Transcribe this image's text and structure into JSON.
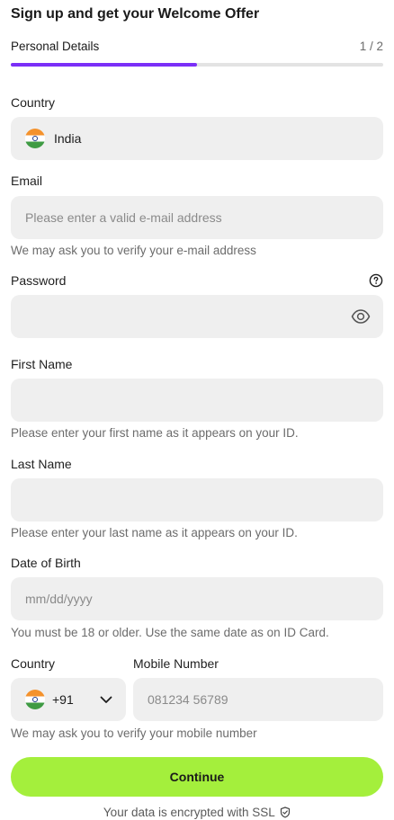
{
  "header": {
    "title": "Sign up and get your Welcome Offer",
    "step_label": "Personal Details",
    "step_count": "1 / 2",
    "progress": 0.5,
    "accent_color": "#7b2ff7"
  },
  "country": {
    "label": "Country",
    "value": "India",
    "flag_icon": "india-flag-icon"
  },
  "email": {
    "label": "Email",
    "placeholder": "Please enter a valid e-mail address",
    "hint": "We may ask you to verify your e-mail address"
  },
  "password": {
    "label": "Password",
    "help_icon": "question-circle-icon",
    "toggle_icon": "eye-icon"
  },
  "first_name": {
    "label": "First Name",
    "hint": "Please enter your first name as it appears on your ID."
  },
  "last_name": {
    "label": "Last Name",
    "hint": "Please enter your last name as it appears on your ID."
  },
  "dob": {
    "label": "Date of Birth",
    "placeholder": "mm/dd/yyyy",
    "hint": "You must be 18 or older. Use the same date as on ID Card."
  },
  "phone": {
    "country_label": "Country",
    "mobile_label": "Mobile Number",
    "code": "+91",
    "placeholder": "081234 56789",
    "hint": "We may ask you to verify your mobile number"
  },
  "actions": {
    "continue_label": "Continue",
    "button_color": "#a4ef3c"
  },
  "footer": {
    "ssl_text": "Your data is encrypted with SSL",
    "shield_icon": "shield-check-icon"
  }
}
